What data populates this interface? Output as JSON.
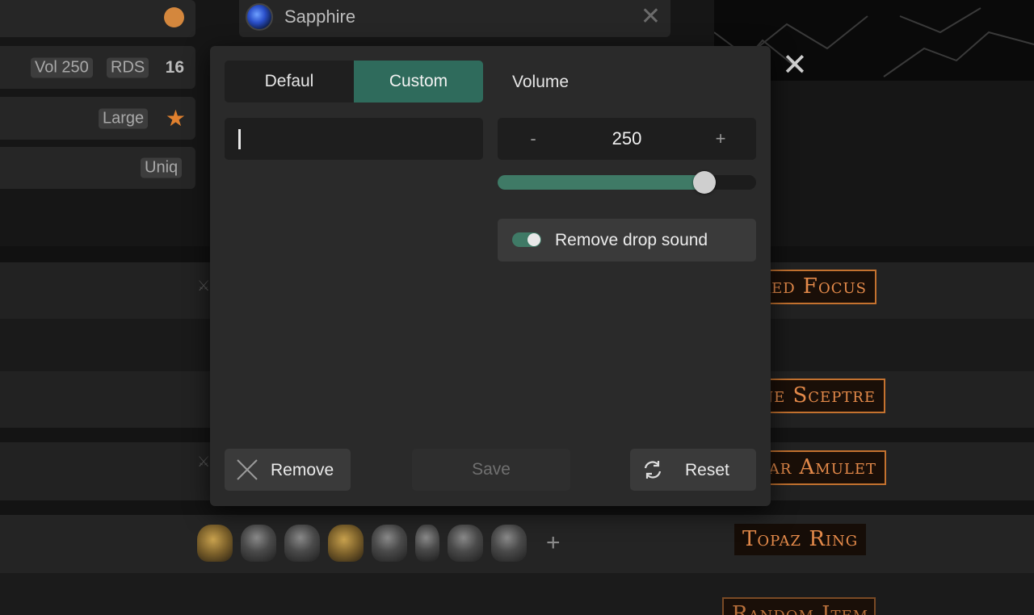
{
  "background": {
    "rows": [
      {
        "tags": [],
        "indicator": "orange-dot"
      },
      {
        "tags": [
          "Vol 250",
          "RDS"
        ],
        "count": "16"
      },
      {
        "tags": [
          "Large"
        ],
        "indicator": "star-icon"
      },
      {
        "tags": [
          "Uniq"
        ]
      }
    ],
    "sapphire_row": {
      "label": "Sapphire",
      "icon": "sapphire-gem-icon"
    },
    "item_labels": [
      "red Focus",
      "ne Sceptre",
      "ar Amulet",
      "Topaz Ring",
      "Random Item"
    ],
    "equipment_add": "+"
  },
  "modal": {
    "tabs": [
      {
        "label": "Defaul",
        "active": false
      },
      {
        "label": "Custom",
        "active": true
      }
    ],
    "volume_tab": "Volume",
    "custom_sound_input": {
      "value": "",
      "placeholder": ""
    },
    "volume_stepper": {
      "minus": "-",
      "value": "250",
      "plus": "+"
    },
    "volume_slider": {
      "fraction": 0.8
    },
    "toggle": {
      "label": "Remove drop sound",
      "checked": true
    },
    "buttons": {
      "remove": "Remove",
      "save": "Save",
      "reset": "Reset"
    }
  },
  "colors": {
    "accent": "#2f6b5c",
    "slider_fill": "#3f7a66",
    "item_label_text": "#e48a4a",
    "item_label_border": "#c4722f",
    "orange_dot": "#d4873d"
  }
}
